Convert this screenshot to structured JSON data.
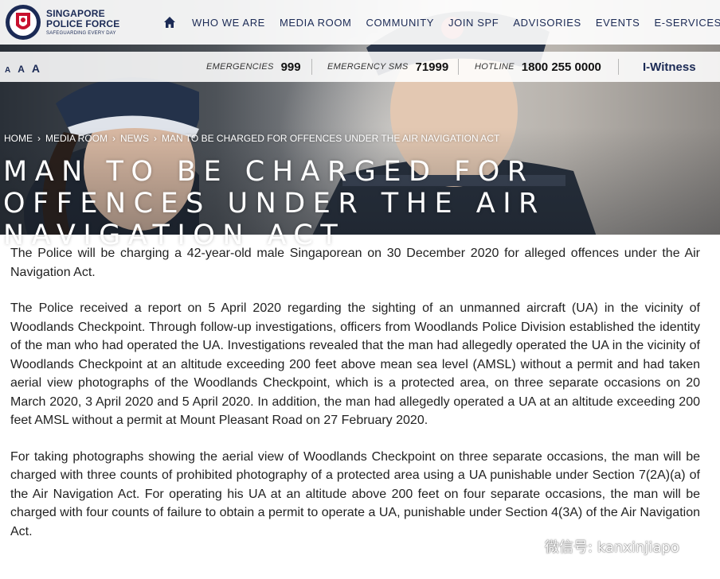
{
  "brand": {
    "line1": "SINGAPORE",
    "line2": "POLICE FORCE",
    "tagline": "SAFEGUARDING EVERY DAY"
  },
  "nav": {
    "items": [
      "WHO WE ARE",
      "MEDIA ROOM",
      "COMMUNITY",
      "JOIN SPF",
      "ADVISORIES",
      "EVENTS",
      "E-SERVICES"
    ],
    "home_icon": "home-icon",
    "search_icon": "search-icon"
  },
  "utility": {
    "font_sizes": [
      "A",
      "A",
      "A"
    ],
    "emergencies_label": "EMERGENCIES",
    "emergencies_number": "999",
    "sms_label": "EMERGENCY SMS",
    "sms_number": "71999",
    "hotline_label": "HOTLINE",
    "hotline_number": "1800 255 0000",
    "iwitness": "I-Witness"
  },
  "breadcrumb": [
    "HOME",
    "MEDIA ROOM",
    "NEWS",
    "MAN TO BE CHARGED FOR OFFENCES UNDER THE AIR NAVIGATION ACT"
  ],
  "title": "MAN TO BE CHARGED FOR OFFENCES UNDER THE AIR NAVIGATION ACT",
  "article": {
    "paragraphs": [
      "The Police will be charging a 42-year-old male Singaporean on 30 December 2020 for alleged offences under the Air Navigation Act.",
      "The Police received a report on 5 April 2020 regarding the sighting of an unmanned aircraft (UA) in the vicinity of Woodlands Checkpoint. Through follow-up investigations, officers from Woodlands Police Division established the identity of the man who had operated the UA. Investigations revealed that the man had allegedly operated the UA in the vicinity of Woodlands Checkpoint at an altitude exceeding 200 feet above mean sea level (AMSL) without a permit and had taken aerial view photographs of the Woodlands Checkpoint, which is a protected area, on three separate occasions on 20 March 2020, 3 April 2020 and 5 April 2020. In addition, the man had allegedly operated a UA at an altitude exceeding 200 feet AMSL without a permit at Mount Pleasant Road on 27 February 2020.",
      "For taking photographs showing the aerial view of Woodlands Checkpoint on three separate occasions, the man will be charged with three counts of prohibited photography of a protected area using a UA punishable under Section 7(2A)(a) of the Air Navigation Act. For operating his UA at an altitude above 200 feet on four separate occasions, the man will be charged with four counts of failure to obtain a permit to operate a UA, punishable under Section 4(3A) of the Air Navigation Act."
    ]
  },
  "watermark": {
    "text": "微信号: kanxinjiapo",
    "icon": "wechat-icon"
  },
  "colors": {
    "navy": "#1b2a55",
    "crest_red": "#c8102e",
    "text": "#222222"
  }
}
